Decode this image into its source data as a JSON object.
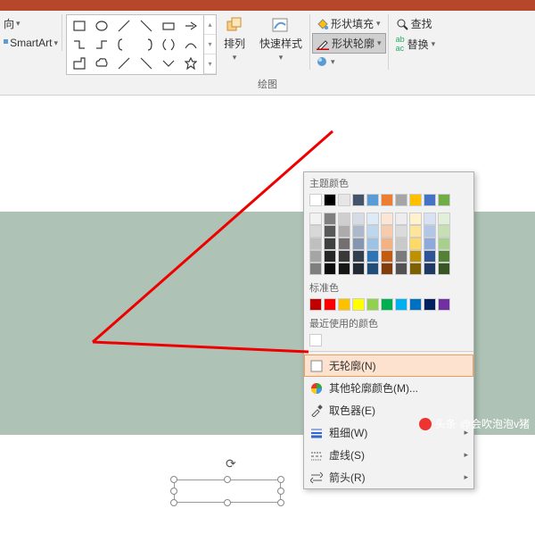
{
  "titlebar": {
    "color": "#b7472a"
  },
  "ribbon": {
    "direction_label": "向",
    "smartart_label": "SmartArt",
    "arrange_label": "排列",
    "quickstyle_label": "快速样式",
    "shape_fill_label": "形状填充",
    "shape_outline_label": "形状轮廓",
    "shape_effects_icon": "形状效果",
    "find_label": "查找",
    "replace_label": "替换",
    "group_drawing_label": "绘图"
  },
  "dropdown": {
    "theme_colors_label": "主题颜色",
    "theme_row_top": [
      "#ffffff",
      "#000000",
      "#e7e6e6",
      "#44546a",
      "#5b9bd5",
      "#ed7d31",
      "#a5a5a5",
      "#ffc000",
      "#4472c4",
      "#70ad47"
    ],
    "theme_shades": [
      [
        "#f2f2f2",
        "#7f7f7f",
        "#d0cece",
        "#d6dce4",
        "#deebf6",
        "#fbe5d5",
        "#ededed",
        "#fff2cc",
        "#d9e2f3",
        "#e2efd9"
      ],
      [
        "#d8d8d8",
        "#595959",
        "#aeabab",
        "#adb9ca",
        "#bdd7ee",
        "#f7cbac",
        "#dbdbdb",
        "#fee599",
        "#b4c6e7",
        "#c5e0b3"
      ],
      [
        "#bfbfbf",
        "#3f3f3f",
        "#757070",
        "#8496b0",
        "#9cc3e5",
        "#f4b183",
        "#c9c9c9",
        "#ffd965",
        "#8eaadb",
        "#a8d08d"
      ],
      [
        "#a5a5a5",
        "#262626",
        "#3a3838",
        "#323f4f",
        "#2e75b5",
        "#c55a11",
        "#7b7b7b",
        "#bf9000",
        "#2f5496",
        "#538135"
      ],
      [
        "#7f7f7f",
        "#0c0c0c",
        "#171616",
        "#222a35",
        "#1e4e79",
        "#833c0b",
        "#525252",
        "#7f6000",
        "#1f3864",
        "#375623"
      ]
    ],
    "standard_colors_label": "标准色",
    "standard_colors": [
      "#c00000",
      "#ff0000",
      "#ffc000",
      "#ffff00",
      "#92d050",
      "#00b050",
      "#00b0f0",
      "#0070c0",
      "#002060",
      "#7030a0"
    ],
    "recent_colors_label": "最近使用的颜色",
    "recent_colors": [
      "#ffffff"
    ],
    "no_outline_label": "无轮廓(N)",
    "more_colors_label": "其他轮廓颜色(M)...",
    "eyedropper_label": "取色器(E)",
    "weight_label": "粗细(W)",
    "dashes_label": "虚线(S)",
    "arrows_label": "箭头(R)"
  },
  "watermark": {
    "prefix": "头条",
    "handle": "@会吹泡泡v猪"
  }
}
